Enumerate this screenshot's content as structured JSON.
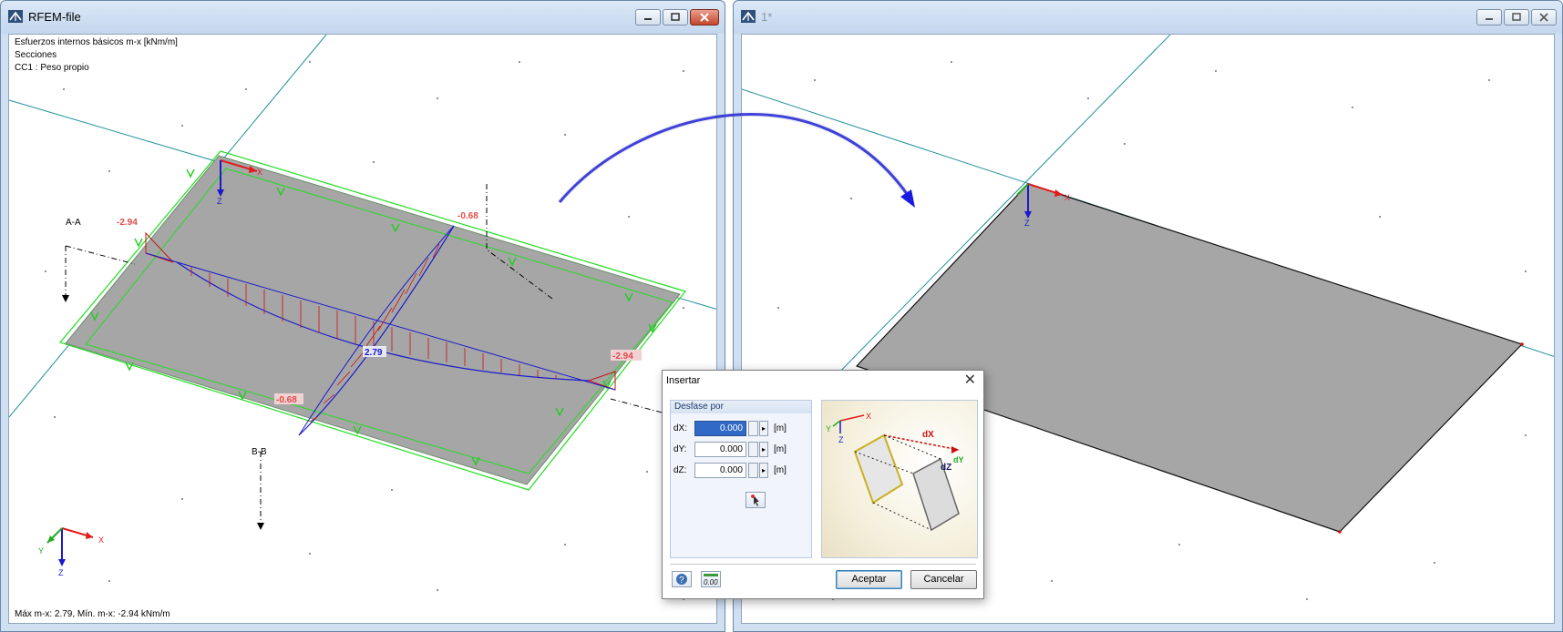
{
  "left_window": {
    "title": "RFEM-file",
    "info_lines": [
      "Esfuerzos internos básicos m-x [kNm/m]",
      "Secciones",
      "CC1 : Peso propio"
    ],
    "status": "Máx m-x: 2.79, Mín. m-x: -2.94 kNm/m",
    "labels": {
      "section_aa": "A-A",
      "section_bb": "B-B",
      "val_left": "-2.94",
      "val_right": "-2.94",
      "val_top": "-0.68",
      "val_bottom": "-0.68",
      "val_max": "2.79",
      "axis_x": "X",
      "axis_z": "Z",
      "corner_x": "X",
      "corner_y": "Y",
      "corner_z": "Z"
    }
  },
  "right_window": {
    "title": "1*",
    "labels": {
      "axis_x": "X",
      "axis_z": "Z"
    }
  },
  "dialog": {
    "title": "Insertar",
    "group_title": "Desfase por",
    "fields": [
      {
        "label": "dX:",
        "value": "0.000",
        "unit": "[m]"
      },
      {
        "label": "dY:",
        "value": "0.000",
        "unit": "[m]"
      },
      {
        "label": "dZ:",
        "value": "0.000",
        "unit": "[m]"
      }
    ],
    "preview_labels": {
      "y": "Y",
      "x": "X",
      "z": "Z",
      "dx": "dX",
      "dy": "dY",
      "dz": "dZ"
    },
    "units_icon_text": "0.00",
    "ok_label": "Aceptar",
    "cancel_label": "Cancelar"
  },
  "colors": {
    "plate": "#a6a6a6",
    "support": "#22dd22",
    "moment_line": "#1a1acc",
    "moment_hatch": "#cc1111",
    "axis_line": "#1f8f9a",
    "arrow": "#1a1ae0"
  }
}
